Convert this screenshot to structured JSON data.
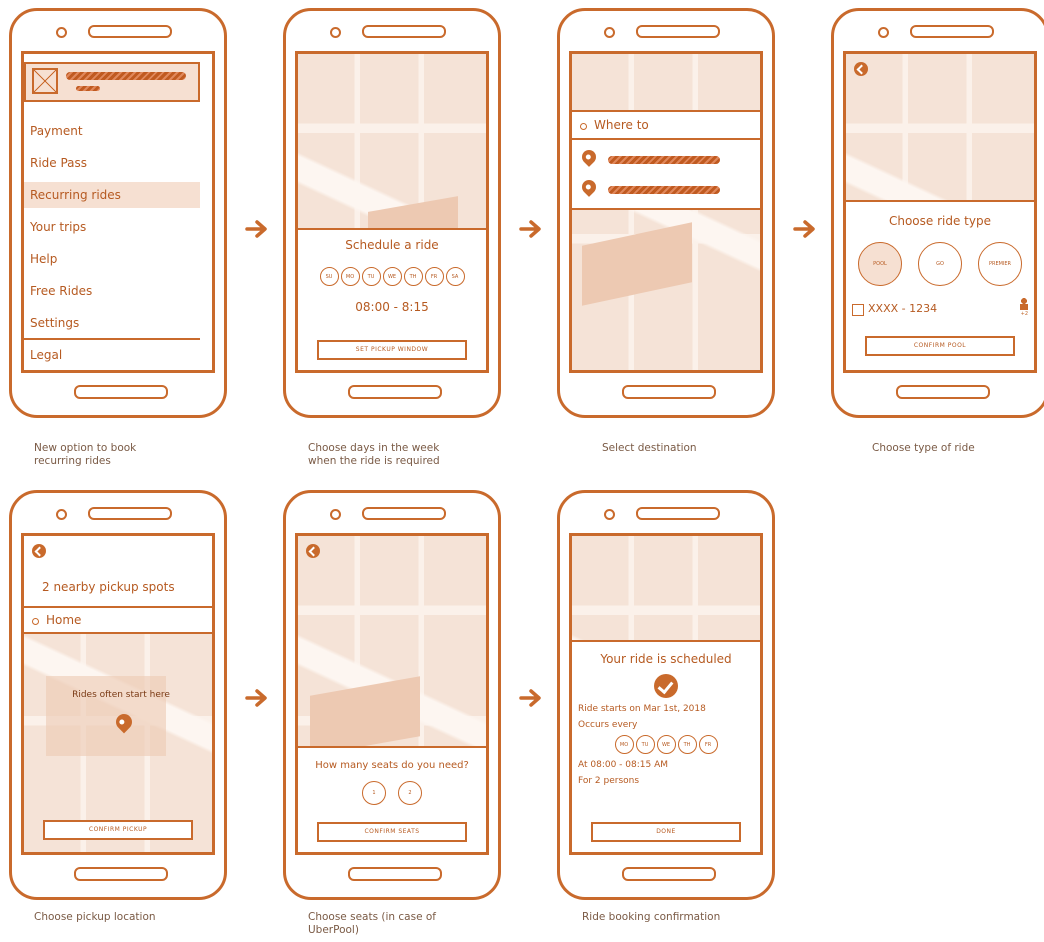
{
  "screen1": {
    "menu": [
      "Payment",
      "Ride Pass",
      "Recurring rides",
      "Your trips",
      "Help",
      "Free Rides",
      "Settings",
      "Legal"
    ],
    "caption": "New option to book\nrecurring rides"
  },
  "screen2": {
    "title": "Schedule a ride",
    "days": [
      "SU",
      "MO",
      "TU",
      "WE",
      "TH",
      "FR",
      "SA"
    ],
    "time": "08:00 - 8:15",
    "button": "SET PICKUP WINDOW",
    "caption": "Choose days in the week\nwhen the ride is required"
  },
  "screen3": {
    "search_placeholder": "Where to",
    "caption": "Select destination"
  },
  "screen4": {
    "title": "Choose ride type",
    "types": [
      "POOL",
      "GO",
      "PREMIER"
    ],
    "card": "XXXX - 1234",
    "seats": "+2",
    "button": "CONFIRM POOL",
    "caption": "Choose type of ride"
  },
  "screen5": {
    "title": "2 nearby pickup spots",
    "location": "Home",
    "hint": "Rides often start here",
    "button": "CONFIRM PICKUP",
    "caption": "Choose pickup location"
  },
  "screen6": {
    "question": "How many seats do you need?",
    "seats": [
      "1",
      "2"
    ],
    "button": "CONFIRM SEATS",
    "caption": "Choose seats (in case of\nUberPool)"
  },
  "screen7": {
    "title": "Your ride is scheduled",
    "start": "Ride starts on Mar 1st, 2018",
    "occurs": "Occurs every",
    "days": [
      "MO",
      "TU",
      "WE",
      "TH",
      "FR"
    ],
    "time": "At 08:00 - 08:15 AM",
    "persons": "For 2 persons",
    "button": "DONE",
    "caption": "Ride booking confirmation"
  },
  "colors": {
    "accent": "#c96a2c",
    "map": "#f5e3d7",
    "highlight": "#f6e0d2"
  },
  "icons": [
    "back-arrow-icon",
    "location-pin-icon",
    "check-icon",
    "card-icon",
    "person-icon",
    "image-placeholder-icon",
    "right-arrow-icon"
  ]
}
